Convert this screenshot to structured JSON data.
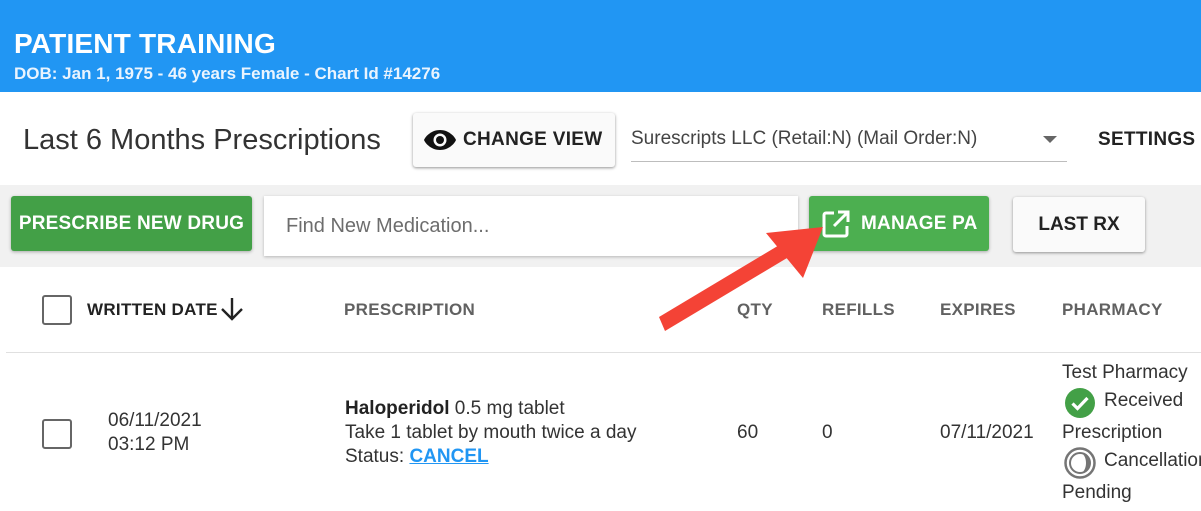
{
  "header": {
    "patient_name": "PATIENT TRAINING",
    "patient_info": "DOB: Jan 1, 1975 - 46 years Female - Chart Id #14276",
    "color": "#2196f3"
  },
  "page": {
    "title": "Last 6 Months Prescriptions"
  },
  "controls": {
    "change_view_label": "CHANGE VIEW",
    "change_view_icon": "eye-icon",
    "network_value": "Surescripts LLC (Retail:N) (Mail Order:N)",
    "settings_label": "SETTINGS"
  },
  "toolbar": {
    "prescribe_label": "PRESCRIBE NEW DRUG",
    "search_placeholder": "Find New Medication...",
    "manage_pa_label": "MANAGE PA",
    "manage_pa_icon": "open-in-new-icon",
    "last_rx_label": "LAST RX",
    "green": "#43a047"
  },
  "table": {
    "columns": {
      "written_date": "WRITTEN DATE",
      "prescription": "PRESCRIPTION",
      "qty": "QTY",
      "refills": "REFILLS",
      "expires": "EXPIRES",
      "pharmacy": "PHARMACY"
    },
    "sort_icon": "arrow-down-icon",
    "rows": [
      {
        "date": "06/11/2021",
        "time": "03:12 PM",
        "drug_name": "Haloperidol",
        "drug_strength": "0.5 mg tablet",
        "sig": "Take 1 tablet by mouth twice a day",
        "status_label": "Status:",
        "status_link": "CANCEL",
        "qty": "60",
        "refills": "0",
        "expires": "07/11/2021",
        "pharmacy_name": "Test Pharmacy",
        "received_label": "Received",
        "prescription_label": "Prescription",
        "cancellation_label": "Cancellation",
        "pending_label": "Pending"
      }
    ]
  },
  "annotation": {
    "arrow_color": "#f44336"
  }
}
